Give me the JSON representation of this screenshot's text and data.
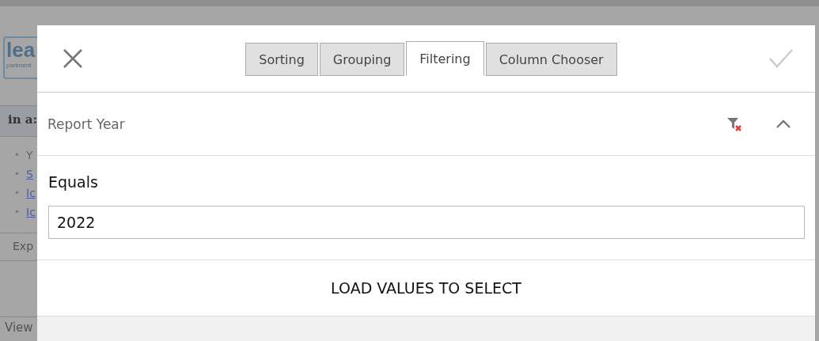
{
  "background_page": {
    "logo": "lea",
    "logo_subtitle": "partment",
    "heading": "in a:",
    "list_items": [
      {
        "marker": "•",
        "text": "Y",
        "kind": "text"
      },
      {
        "marker": "•",
        "text": "S",
        "kind": "link"
      },
      {
        "marker": "•",
        "text": "Ic",
        "kind": "link"
      },
      {
        "marker": "•",
        "text": "Ic",
        "kind": "link"
      }
    ],
    "toolbar_text": "Exp",
    "footer_text": "View"
  },
  "dialog": {
    "tabs": [
      {
        "label": "Sorting",
        "selected": false
      },
      {
        "label": "Grouping",
        "selected": false
      },
      {
        "label": "Filtering",
        "selected": true
      },
      {
        "label": "Column Chooser",
        "selected": false
      }
    ],
    "filter": {
      "column": "Report Year",
      "expanded": true,
      "operator": "Equals",
      "value": "2022"
    },
    "load_button": "LOAD VALUES TO SELECT"
  }
}
